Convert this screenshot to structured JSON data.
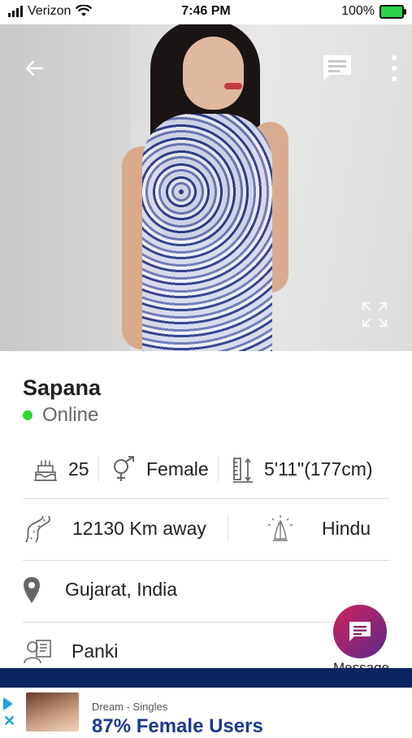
{
  "status_bar": {
    "carrier": "Verizon",
    "time": "7:46 PM",
    "battery": "100%"
  },
  "profile": {
    "name": "Sapana",
    "status": "Online",
    "age": "25",
    "gender": "Female",
    "height": "5'11\"(177cm)",
    "distance": "12130 Km away",
    "religion": "Hindu",
    "location": "Gujarat, India",
    "caste": "Panki"
  },
  "fab": {
    "label": "Message"
  },
  "ad": {
    "subtitle": "Dream - Singles",
    "title": "87% Female Users"
  },
  "icons": {
    "back": "back-arrow-icon",
    "chat": "chat-bubble-icon",
    "more": "more-vertical-icon",
    "expand": "expand-icon",
    "age": "cake-icon",
    "gender": "gender-icon",
    "height": "height-ruler-icon",
    "distance": "road-icon",
    "religion": "prayer-hands-icon",
    "location": "location-pin-icon",
    "caste": "profile-card-icon",
    "message": "message-icon"
  },
  "colors": {
    "online": "#2fd62f",
    "fab_start": "#d0225a",
    "fab_end": "#5b2a8c",
    "navy_bar": "#0c2461",
    "ad_title": "#1b3a8c"
  }
}
